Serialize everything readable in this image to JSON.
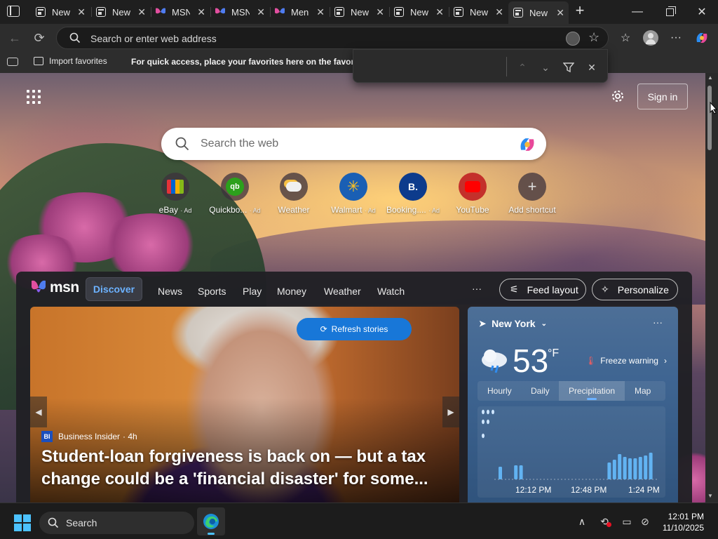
{
  "tabs": [
    {
      "title": "New",
      "icon": "new-tab-page-icon"
    },
    {
      "title": "New",
      "icon": "new-tab-page-icon"
    },
    {
      "title": "MSN",
      "icon": "msn-butterfly-icon"
    },
    {
      "title": "MSN",
      "icon": "msn-butterfly-icon"
    },
    {
      "title": "Men",
      "icon": "msn-butterfly-icon"
    },
    {
      "title": "New",
      "icon": "new-tab-page-icon"
    },
    {
      "title": "New",
      "icon": "new-tab-page-icon"
    },
    {
      "title": "New",
      "icon": "new-tab-page-icon"
    },
    {
      "title": "New",
      "icon": "new-tab-page-icon",
      "active": true
    }
  ],
  "address_bar": {
    "placeholder": "Search or enter web address"
  },
  "favorites_bar": {
    "import_label": "Import favorites",
    "hint": "For quick access, place your favorites here on the favorites"
  },
  "ntp": {
    "sign_in": "Sign in",
    "search_placeholder": "Search the web",
    "shortcuts": [
      {
        "label": "eBay",
        "ad": "· Ad"
      },
      {
        "label": "Quickbo...",
        "ad": "· Ad"
      },
      {
        "label": "Weather",
        "ad": ""
      },
      {
        "label": "Walmart",
        "ad": "· Ad"
      },
      {
        "label": "Booking....",
        "ad": "· Ad"
      },
      {
        "label": "YouTube",
        "ad": ""
      },
      {
        "label": "Add shortcut",
        "ad": ""
      }
    ]
  },
  "feed": {
    "logo": "msn",
    "tabs": [
      "Discover",
      "News",
      "Sports",
      "Play",
      "Money",
      "Weather",
      "Watch"
    ],
    "more": "···",
    "feed_layout": "Feed layout",
    "personalize": "Personalize",
    "refresh": "Refresh stories",
    "hero": {
      "source": "Business Insider",
      "source_badge": "BI",
      "age": "· 4h",
      "headline": "Student-loan forgiveness is back on — but a tax change could be a 'financial disaster' for some..."
    },
    "weather": {
      "location": "New York",
      "temperature": "53",
      "unit": "°F",
      "alert": "Freeze warning",
      "tabs": [
        "Hourly",
        "Daily",
        "Precipitation",
        "Map"
      ],
      "selected_tab": "Precipitation",
      "chart_times": [
        "12:12 PM",
        "12:48 PM",
        "1:24 PM"
      ]
    }
  },
  "taskbar": {
    "search": "Search",
    "time": "12:01 PM",
    "date": "11/10/2025"
  },
  "colors": {
    "accent": "#1877d8",
    "discover": "#6cb2ff",
    "bar": "#62b3f2"
  }
}
